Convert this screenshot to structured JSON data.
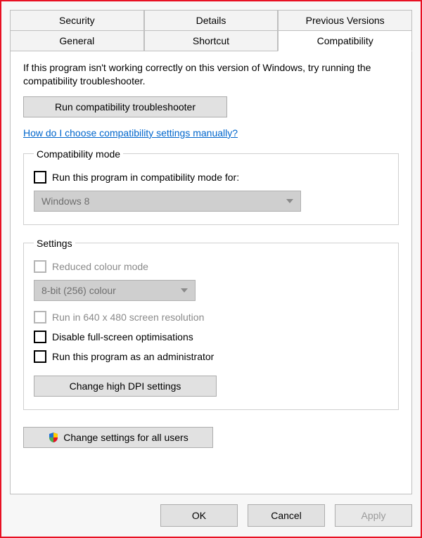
{
  "tabs": {
    "row1": [
      "Security",
      "Details",
      "Previous Versions"
    ],
    "row2": [
      "General",
      "Shortcut",
      "Compatibility"
    ],
    "active": "Compatibility"
  },
  "intro": "If this program isn't working correctly on this version of Windows, try running the compatibility troubleshooter.",
  "buttons": {
    "troubleshooter": "Run compatibility troubleshooter",
    "help_link": "How do I choose compatibility settings manually?",
    "dpi": "Change high DPI settings",
    "all_users": "Change settings for all users",
    "ok": "OK",
    "cancel": "Cancel",
    "apply": "Apply"
  },
  "group_compat": {
    "legend": "Compatibility mode",
    "checkbox_label": "Run this program in compatibility mode for:",
    "select_value": "Windows 8"
  },
  "group_settings": {
    "legend": "Settings",
    "reduced_colour": "Reduced colour mode",
    "colour_select": "8-bit (256) colour",
    "low_res": "Run in 640 x 480 screen resolution",
    "disable_fullscreen": "Disable full-screen optimisations",
    "run_admin": "Run this program as an administrator"
  }
}
